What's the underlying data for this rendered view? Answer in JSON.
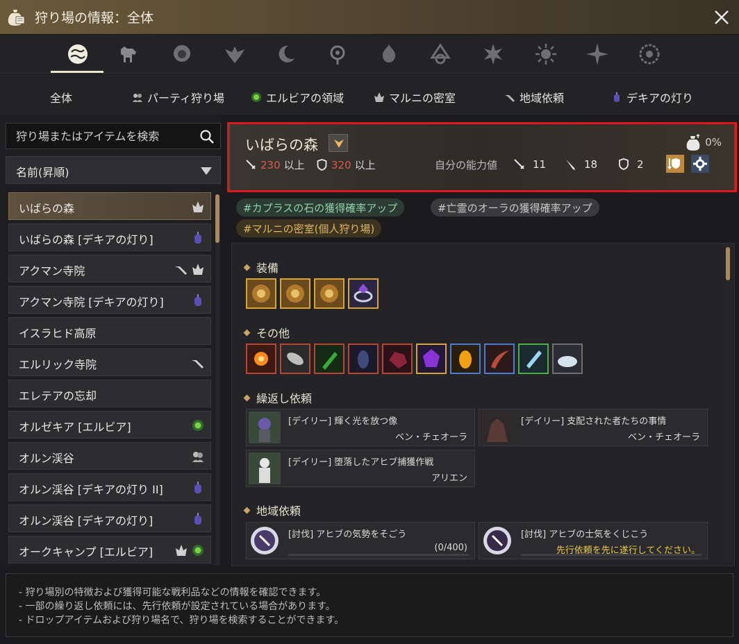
{
  "window": {
    "title": "狩り場の情報：全体"
  },
  "icons": [
    "all-zones-icon",
    "horse-icon",
    "lion-icon",
    "winged-crest-icon",
    "crescent-moon-icon",
    "elvia-orb-icon",
    "flame-crest-icon",
    "tree-emblem-icon",
    "star-burst-icon",
    "sun-burst-icon",
    "compass-star-icon",
    "spiral-seal-icon"
  ],
  "tabs": [
    {
      "label": "全体"
    },
    {
      "label": "パーティ狩り場"
    },
    {
      "label": "エルビアの領域"
    },
    {
      "label": "マルニの密室"
    },
    {
      "label": "地域依頼"
    },
    {
      "label": "デキアの灯り"
    }
  ],
  "search": {
    "placeholder": "狩り場またはアイテムを検索"
  },
  "sort": {
    "selected": "名前(昇順)"
  },
  "list": [
    {
      "label": "いばらの森"
    },
    {
      "label": "いばらの森 [デキアの灯り]"
    },
    {
      "label": "アクマン寺院"
    },
    {
      "label": "アクマン寺院 [デキアの灯り]"
    },
    {
      "label": "イスラヒド高原"
    },
    {
      "label": "エルリック寺院"
    },
    {
      "label": "エレテアの忘却"
    },
    {
      "label": "オルゼキア [エルビア]"
    },
    {
      "label": "オルン渓谷"
    },
    {
      "label": "オルン渓谷 [デキアの灯り II]"
    },
    {
      "label": "オルン渓谷 [デキアの灯り]"
    },
    {
      "label": "オークキャンプ [エルビア]"
    }
  ],
  "header": {
    "zone_name": "いばらの森",
    "ap_value": "230",
    "dp_value": "320",
    "req_suffix": "以上",
    "drop_rate": "0%",
    "my_stats_label": "自分の能力値",
    "my_ap": "11",
    "my_awk_ap": "18",
    "my_dp": "2"
  },
  "tags": [
    "#カプラスの石の獲得確率アップ",
    "#亡霊のオーラの獲得確率アップ",
    "#マルニの密室(個人狩り場)"
  ],
  "sections": {
    "equipment": "装備",
    "other": "その他",
    "repeat_quests": "繰返し依頼",
    "region_quests": "地域依頼"
  },
  "repeat_quests": [
    {
      "title": "[デイリー] 輝く光を放つ像",
      "npc": "ベン・チェオーラ"
    },
    {
      "title": "[デイリー] 支配された者たちの事情",
      "npc": "ベン・チェオーラ"
    },
    {
      "title": "[デイリー] 堕落したアヒブ捕獲作戦",
      "npc": "アリエン"
    }
  ],
  "region_quests": [
    {
      "title": "[討伐] アヒブの気勢をそごう",
      "status": "(0/400)"
    },
    {
      "title": "[討伐] アヒブの士気をくじこう",
      "status": "先行依頼を先に遂行してください。"
    }
  ],
  "footer": [
    "- 狩り場別の特徴および獲得可能な戦利品などの情報を確認できます。",
    "- 一部の繰り返し依頼には、先行依頼が設定されている場合があります。",
    "- ドロップアイテムおよび狩り場名で、狩り場を検索することができます。"
  ],
  "colors": {
    "accent_gold": "#c9a465",
    "requirement_red": "#e0574d",
    "warning_yellow": "#e8c84a",
    "highlight_box": "#e0181e"
  }
}
